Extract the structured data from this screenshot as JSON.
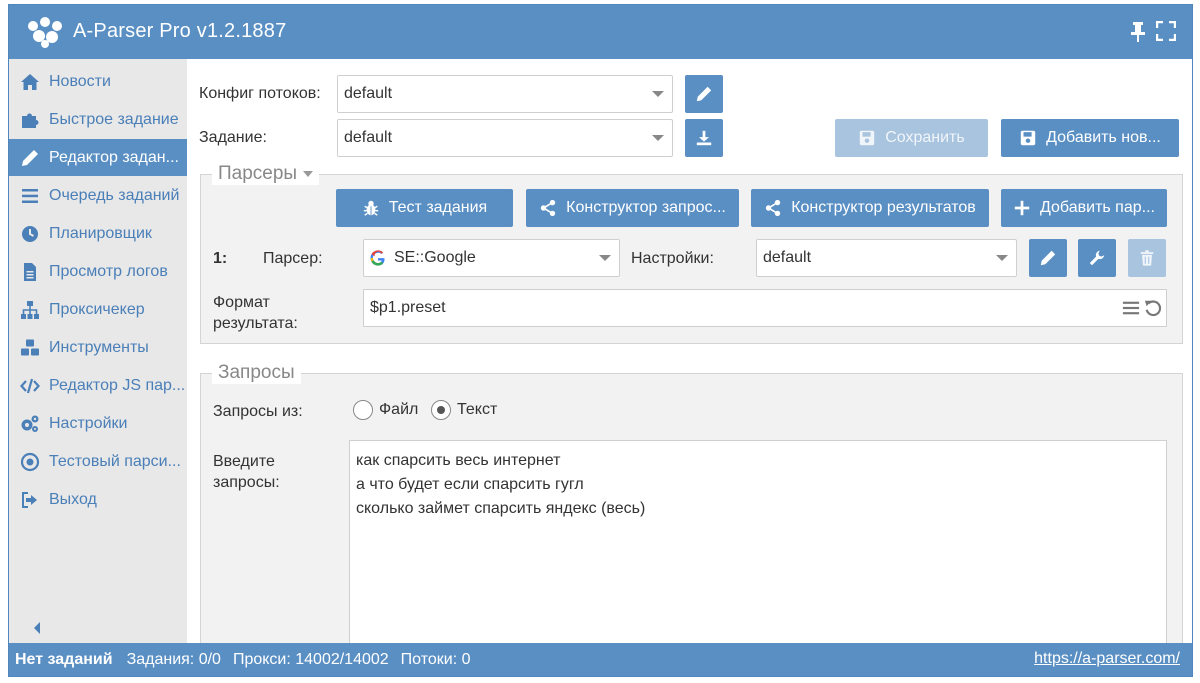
{
  "window": {
    "title": "A-Parser Pro v1.2.1887"
  },
  "colors": {
    "accent": "#5a8fc4",
    "sidebar_bg": "#e8e8e8",
    "link": "#4a7fb8",
    "disabled": "#a9c4df"
  },
  "sidebar": {
    "items": [
      {
        "label": "Новости",
        "icon": "home-icon"
      },
      {
        "label": "Быстрое задание",
        "icon": "puzzle-icon"
      },
      {
        "label": "Редактор задан...",
        "icon": "pencil-icon",
        "active": true
      },
      {
        "label": "Очередь заданий",
        "icon": "list-icon"
      },
      {
        "label": "Планировщик",
        "icon": "clock-icon"
      },
      {
        "label": "Просмотр логов",
        "icon": "file-icon"
      },
      {
        "label": "Проксичекер",
        "icon": "sitemap-icon"
      },
      {
        "label": "Инструменты",
        "icon": "cubes-icon"
      },
      {
        "label": "Редактор JS пар...",
        "icon": "code-icon"
      },
      {
        "label": "Настройки",
        "icon": "gears-icon"
      },
      {
        "label": "Тестовый парси...",
        "icon": "target-icon"
      },
      {
        "label": "Выход",
        "icon": "sign-out-icon"
      }
    ]
  },
  "top": {
    "threads_label": "Конфиг потоков:",
    "threads_value": "default",
    "task_label": "Задание:",
    "task_value": "default",
    "save_label": "Сохранить",
    "add_new_label": "Добавить нов..."
  },
  "parsers": {
    "legend": "Парсеры",
    "test_task_label": "Тест задания",
    "query_builder_label": "Конструктор запрос...",
    "result_builder_label": "Конструктор результатов",
    "add_parser_label": "Добавить пар...",
    "row_index": "1:",
    "parser_label": "Парсер:",
    "parser_value": "SE::Google",
    "settings_label": "Настройки:",
    "settings_value": "default",
    "format_label_1": "Формат",
    "format_label_2": "результата:",
    "format_value": "$p1.preset"
  },
  "queries": {
    "legend": "Запросы",
    "from_label": "Запросы из:",
    "option_file": "Файл",
    "option_text": "Текст",
    "selected": "text",
    "enter_label_1": "Введите",
    "enter_label_2": "запросы:",
    "lines": [
      "как спарсить весь интернет",
      "а что будет если спарсить гугл",
      "сколько займет спарсить яндекс (весь)"
    ]
  },
  "status": {
    "no_tasks": "Нет заданий",
    "tasks": "Задания: 0/0",
    "proxies": "Прокси: 14002/14002",
    "threads": "Потоки: 0",
    "link": "https://a-parser.com/"
  }
}
